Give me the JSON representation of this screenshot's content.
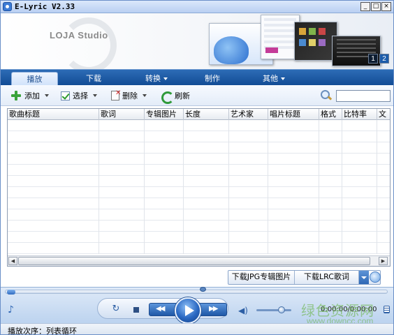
{
  "window": {
    "title": "E-Lyric V2.33",
    "controls": [
      "_",
      "□",
      "×"
    ]
  },
  "banner": {
    "brand": "LOJA Studio",
    "pages": [
      "1",
      "2"
    ]
  },
  "tabs": [
    {
      "label": "播放",
      "active": true,
      "dropdown": false
    },
    {
      "label": "下载",
      "active": false,
      "dropdown": false
    },
    {
      "label": "转换",
      "active": false,
      "dropdown": true
    },
    {
      "label": "制作",
      "active": false,
      "dropdown": false
    },
    {
      "label": "其他",
      "active": false,
      "dropdown": true
    }
  ],
  "toolbar": {
    "add_label": "添加",
    "select_label": "选择",
    "delete_label": "删除",
    "refresh_label": "刷新",
    "search_value": ""
  },
  "table": {
    "columns": [
      "歌曲标题",
      "歌词",
      "专辑图片",
      "长度",
      "艺术家",
      "唱片标题",
      "格式",
      "比特率",
      "文"
    ],
    "rows": []
  },
  "downloads": {
    "jpg_label": "下载JPG专辑图片",
    "lrc_label": "下载LRC歌词"
  },
  "player": {
    "time": "0:00:00/0:00:00",
    "seek_fraction": 0,
    "volume_fraction": 0.75
  },
  "watermark": {
    "text": "绿色资源网",
    "url": "www.downcc.com"
  },
  "status": {
    "text": "播放次序：列表循环"
  },
  "colors": {
    "tabbar": "#1a5aa5",
    "accent": "#2f6bc0",
    "watermark": "#62b03b"
  }
}
